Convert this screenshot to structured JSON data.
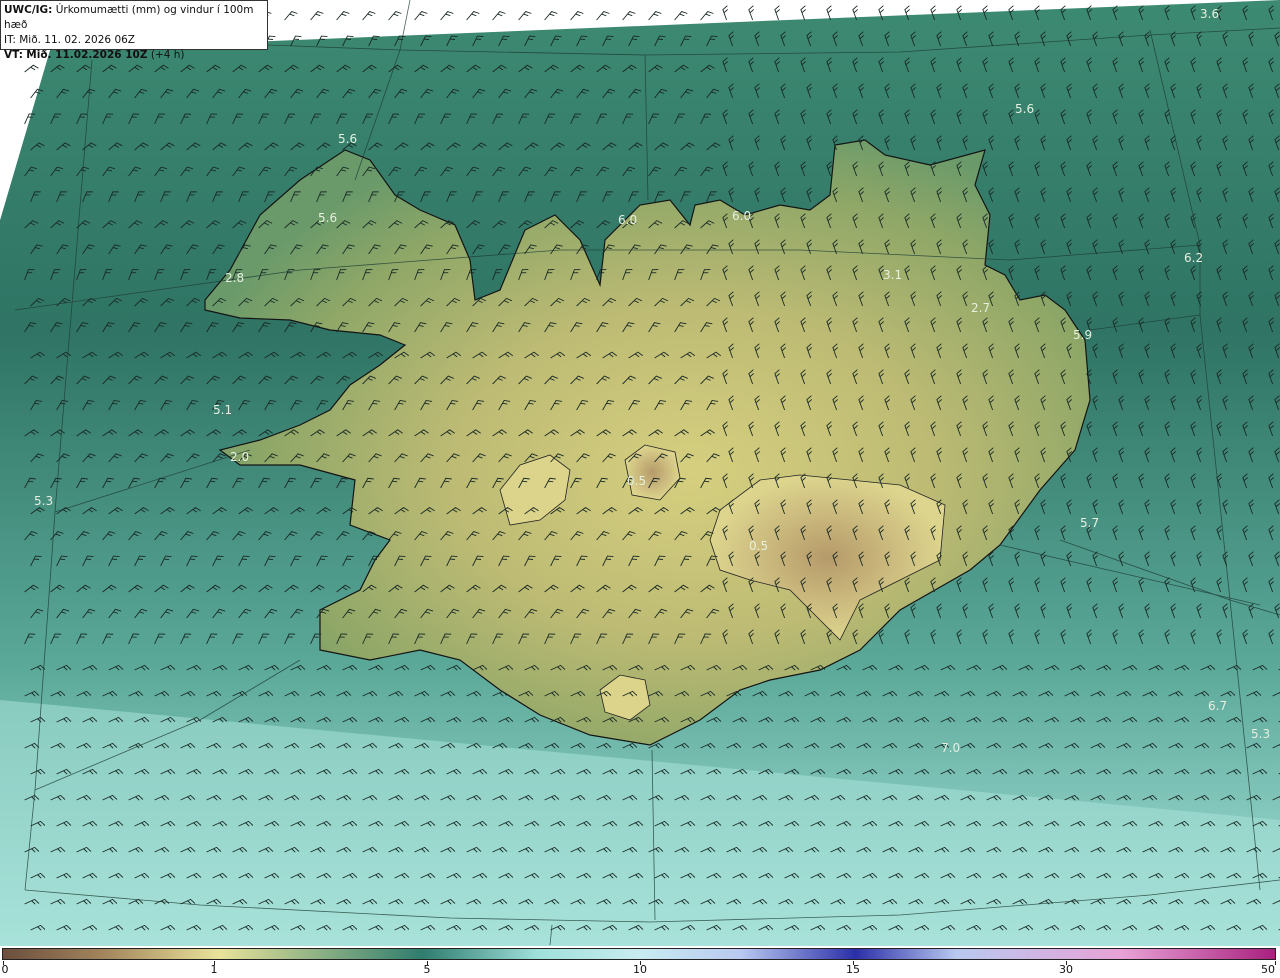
{
  "header": {
    "model": "UWC/IG:",
    "title": "Úrkomumætti (mm) og vindur í 100m hæð",
    "it_line": "IT: Mið. 11. 02. 2026 06Z",
    "vt_label": "VT:",
    "vt_value": "Mið. 11.02.2026 10Z",
    "vt_offset": "(+4 h)"
  },
  "contour_labels": [
    "3.6",
    "5.6",
    "5.6",
    "5.6",
    "6.0",
    "6.0",
    "2.8",
    "3.1",
    "6.2",
    "2.7",
    "5.9",
    "5.1",
    "2.0",
    "0.5",
    "5.3",
    "0.5",
    "5.7",
    "6.7",
    "5.3",
    "7.0"
  ],
  "colorbar": {
    "ticks": [
      "0",
      "1",
      "5",
      "10",
      "15",
      "30",
      "50"
    ],
    "colors": [
      "#6b4e3d",
      "#a3865d",
      "#e9e39a",
      "#2e7d6e",
      "#9fe0db",
      "#c8ecf0",
      "#2b2fa8",
      "#b9c9f0",
      "#e8a2d6",
      "#a8207e"
    ]
  },
  "map_colors": {
    "ocean_dark": "#2f6b5d",
    "ocean_mid": "#3e8a73",
    "ocean_light": "#8fd0c6",
    "land_low": "#8fa85f",
    "land_high": "#e0d98e",
    "coast": "#1a1a1a"
  }
}
